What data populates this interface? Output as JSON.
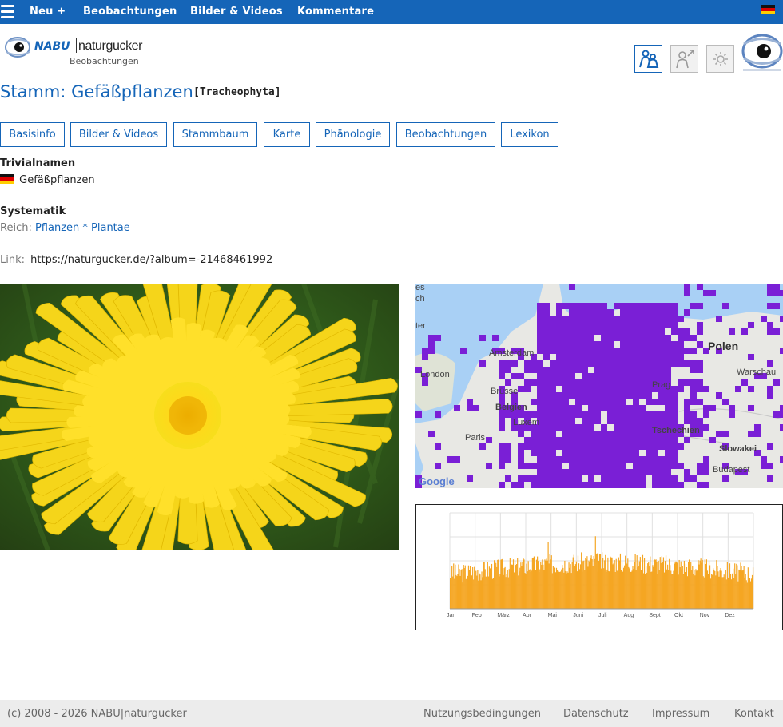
{
  "topbar": {
    "nav": [
      {
        "label": "Neu +"
      },
      {
        "label": "Beobachtungen"
      },
      {
        "label": "Bilder & Videos"
      },
      {
        "label": "Kommentare"
      }
    ],
    "language_flag": "flag-de-icon"
  },
  "logo": {
    "brand": "NABU",
    "name": "naturgucker",
    "subtitle": "Beobachtungen"
  },
  "header": {
    "title": "Stamm: Gefäßpflanzen",
    "scientific": "[Tracheophyta]"
  },
  "tabs": [
    {
      "label": "Basisinfo"
    },
    {
      "label": "Bilder & Videos"
    },
    {
      "label": "Stammbaum"
    },
    {
      "label": "Karte"
    },
    {
      "label": "Phänologie"
    },
    {
      "label": "Beobachtungen"
    },
    {
      "label": "Lexikon"
    }
  ],
  "info": {
    "common_names_heading": "Trivialnamen",
    "common_name": "Gefäßpflanzen",
    "systematics_heading": "Systematik",
    "kingdom_label": "Reich:",
    "kingdom_value": "Pflanzen * Plantae",
    "link_label": "Link:",
    "link_value": "https://naturgucker.de/?album=-21468461992"
  },
  "map": {
    "labels": [
      "es",
      "ch",
      "ter",
      "London",
      "Amsterdam",
      "Brüssel",
      "Belgien",
      "Luxem",
      "Paris",
      "Polen",
      "Warschau",
      "Prag",
      "Tschechien",
      "Slowakei",
      "Budapest"
    ],
    "google": "Google"
  },
  "phenology": {
    "months": [
      "Jan",
      "Feb",
      "März",
      "Apr",
      "Mai",
      "Juni",
      "Juli",
      "Aug",
      "Sept",
      "Okt",
      "Nov",
      "Dez"
    ],
    "bar_color": "#f5a623"
  },
  "footer": {
    "copyright": "(c) 2008 - 2026 NABU|naturgucker",
    "links": [
      "Nutzungsbedingungen",
      "Datenschutz",
      "Impressum",
      "Kontakt"
    ]
  },
  "colors": {
    "accent": "#1565b8",
    "map_overlay": "#7a1fd6"
  }
}
